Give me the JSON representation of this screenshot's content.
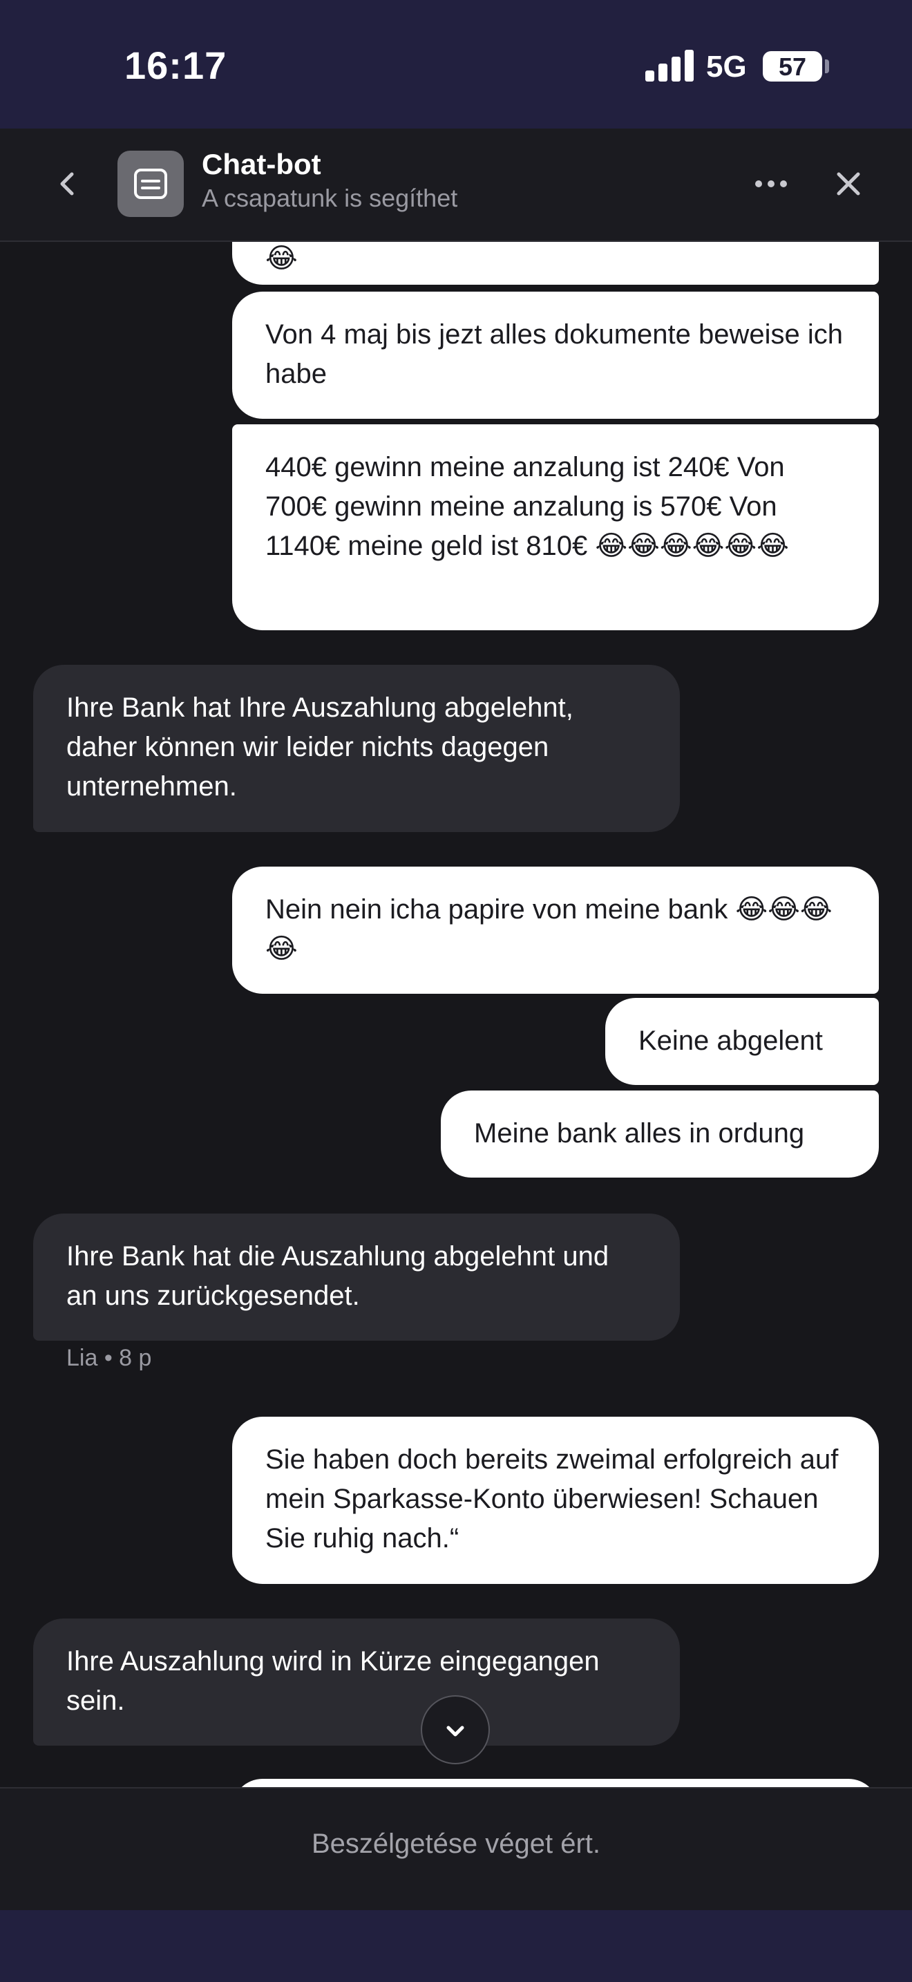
{
  "status_bar": {
    "time": "16:17",
    "network": "5G",
    "battery": "57"
  },
  "header": {
    "title": "Chat-bot",
    "subtitle": "A csapatunk is segíthet",
    "back_icon": "chevron-left-icon",
    "more_icon": "more-horizontal-icon",
    "close_icon": "close-icon",
    "avatar_icon": "bot-icon"
  },
  "messages": [
    {
      "from": "me",
      "text": "😂"
    },
    {
      "from": "me",
      "text": "Von 4 maj bis jezt alles dokumente beweise ich habe"
    },
    {
      "from": "me",
      "text": "440€ gewinn meine anzalung ist 240€ Von 700€ gewinn meine anzalung is 570€ Von 1140€ meine geld ist 810€ 😂😂😂😂😂😂"
    },
    {
      "from": "bot",
      "text": "Ihre Bank hat Ihre Auszahlung abgelehnt, daher können wir leider nichts dagegen unternehmen."
    },
    {
      "from": "me",
      "text": "Nein nein icha papire von meine bank 😂😂😂😂"
    },
    {
      "from": "me",
      "text": "Keine abgelent"
    },
    {
      "from": "me",
      "text": "Meine bank alles in ordung"
    },
    {
      "from": "bot",
      "text": "Ihre Bank hat die Auszahlung abgelehnt und an uns zurückgesendet."
    },
    {
      "from": "me",
      "text": "Sie haben doch bereits zweimal erfolgreich auf mein Sparkasse-Konto überwiesen! Schauen Sie ruhig nach.“"
    },
    {
      "from": "bot",
      "text": "Ihre Auszahlung wird in Kürze eingegangen sein."
    }
  ],
  "meta_lia": "Lia • 8 p",
  "footer": {
    "text": "Beszélgetése véget ért."
  },
  "colors": {
    "status_bg": "#22203f",
    "chat_bg": "#17171b",
    "bot_bubble": "#2b2b31",
    "user_bubble": "#ffffff"
  }
}
